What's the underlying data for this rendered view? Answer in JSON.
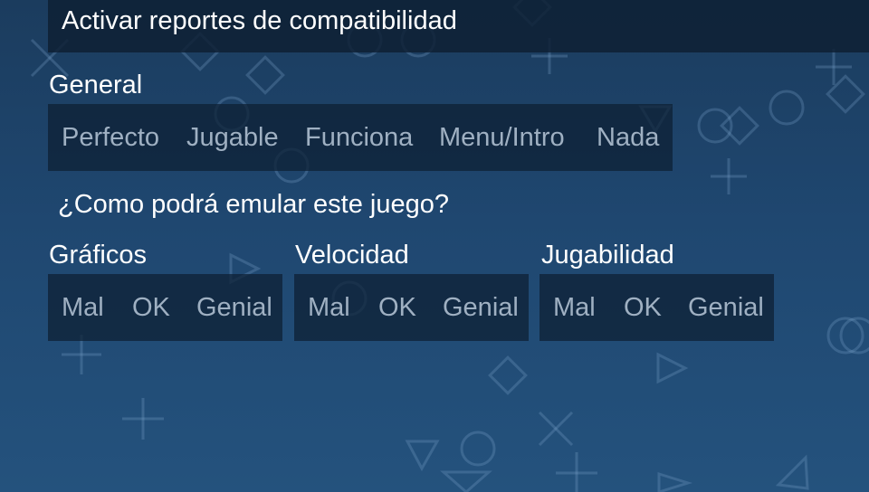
{
  "header": {
    "title": "Activar reportes de compatibilidad"
  },
  "general": {
    "label": "General",
    "options": [
      "Perfecto",
      "Jugable",
      "Funciona",
      "Menu/Intro",
      "Nada"
    ]
  },
  "question": "¿Como podrá emular este juego?",
  "ratings": [
    {
      "label": "Gráficos",
      "options": [
        "Mal",
        "OK",
        "Genial"
      ]
    },
    {
      "label": "Velocidad",
      "options": [
        "Mal",
        "OK",
        "Genial"
      ]
    },
    {
      "label": "Jugabilidad",
      "options": [
        "Mal",
        "OK",
        "Genial"
      ]
    }
  ],
  "colors": {
    "background_top": "#1b3c5e",
    "background_bottom": "#24527d",
    "panel": "#0d1e32",
    "text": "#ffffff",
    "option_text": "#9fb0c2",
    "pattern": "#7fa6cc"
  }
}
